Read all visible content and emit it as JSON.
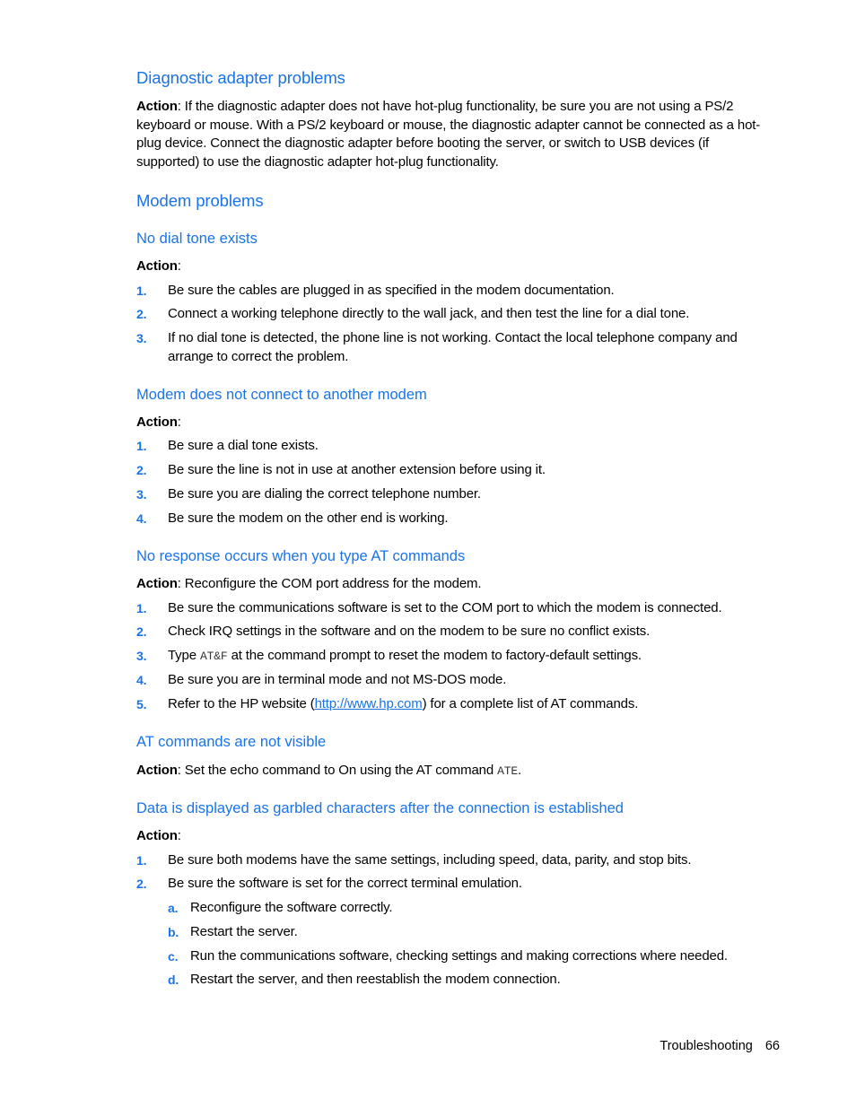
{
  "sections": {
    "diagnostic": {
      "heading": "Diagnostic adapter problems",
      "action_label": "Action",
      "action_text": ": If the diagnostic adapter does not have hot-plug functionality, be sure you are not using a PS/2 keyboard or mouse. With a PS/2 keyboard or mouse, the diagnostic adapter cannot be connected as a hot-plug device. Connect the diagnostic adapter before booting the server, or switch to USB devices (if supported) to use the diagnostic adapter hot-plug functionality."
    },
    "modem": {
      "heading": "Modem problems",
      "no_dial_tone": {
        "heading": "No dial tone exists",
        "action_label": "Action",
        "action_suffix": ":",
        "steps": [
          {
            "num": "1.",
            "text": "Be sure the cables are plugged in as specified in the modem documentation."
          },
          {
            "num": "2.",
            "text": "Connect a working telephone directly to the wall jack, and then test the line for a dial tone."
          },
          {
            "num": "3.",
            "text": "If no dial tone is detected, the phone line is not working. Contact the local telephone company and arrange to correct the problem."
          }
        ]
      },
      "no_connect": {
        "heading": "Modem does not connect to another modem",
        "action_label": "Action",
        "action_suffix": ":",
        "steps": [
          {
            "num": "1.",
            "text": "Be sure a dial tone exists."
          },
          {
            "num": "2.",
            "text": "Be sure the line is not in use at another extension before using it."
          },
          {
            "num": "3.",
            "text": "Be sure you are dialing the correct telephone number."
          },
          {
            "num": "4.",
            "text": "Be sure the modem on the other end is working."
          }
        ]
      },
      "no_response": {
        "heading": "No response occurs when you type AT commands",
        "action_label": "Action",
        "action_text": ": Reconfigure the COM port address for the modem.",
        "steps": [
          {
            "num": "1.",
            "text": "Be sure the communications software is set to the COM port to which the modem is connected."
          },
          {
            "num": "2.",
            "text": "Check IRQ settings in the software and on the modem to be sure no conflict exists."
          },
          {
            "num": "3.",
            "pre": "Type ",
            "code": "AT&F",
            "post": " at the command prompt to reset the modem to factory-default settings."
          },
          {
            "num": "4.",
            "text": "Be sure you are in terminal mode and not MS-DOS mode."
          },
          {
            "num": "5.",
            "pre": "Refer to the HP website (",
            "link": "http://www.hp.com",
            "post": ") for a complete list of AT commands."
          }
        ]
      },
      "not_visible": {
        "heading": "AT commands are not visible",
        "action_label": "Action",
        "action_text": ": Set the echo command to On using the AT command ",
        "code": "ATE",
        "action_end": "."
      },
      "garbled": {
        "heading": "Data is displayed as garbled characters after the connection is established",
        "action_label": "Action",
        "action_suffix": ":",
        "steps": [
          {
            "num": "1.",
            "text": "Be sure both modems have the same settings, including speed, data, parity, and stop bits."
          },
          {
            "num": "2.",
            "text": "Be sure the software is set for the correct terminal emulation."
          }
        ],
        "substeps": [
          {
            "num": "a.",
            "text": "Reconfigure the software correctly."
          },
          {
            "num": "b.",
            "text": "Restart the server."
          },
          {
            "num": "c.",
            "text": "Run the communications software, checking settings and making corrections where needed."
          },
          {
            "num": "d.",
            "text": "Restart the server, and then reestablish the modem connection."
          }
        ]
      }
    }
  },
  "footer": {
    "section": "Troubleshooting",
    "page": "66"
  },
  "colors": {
    "heading": "#1a73e8",
    "body": "#000000"
  }
}
